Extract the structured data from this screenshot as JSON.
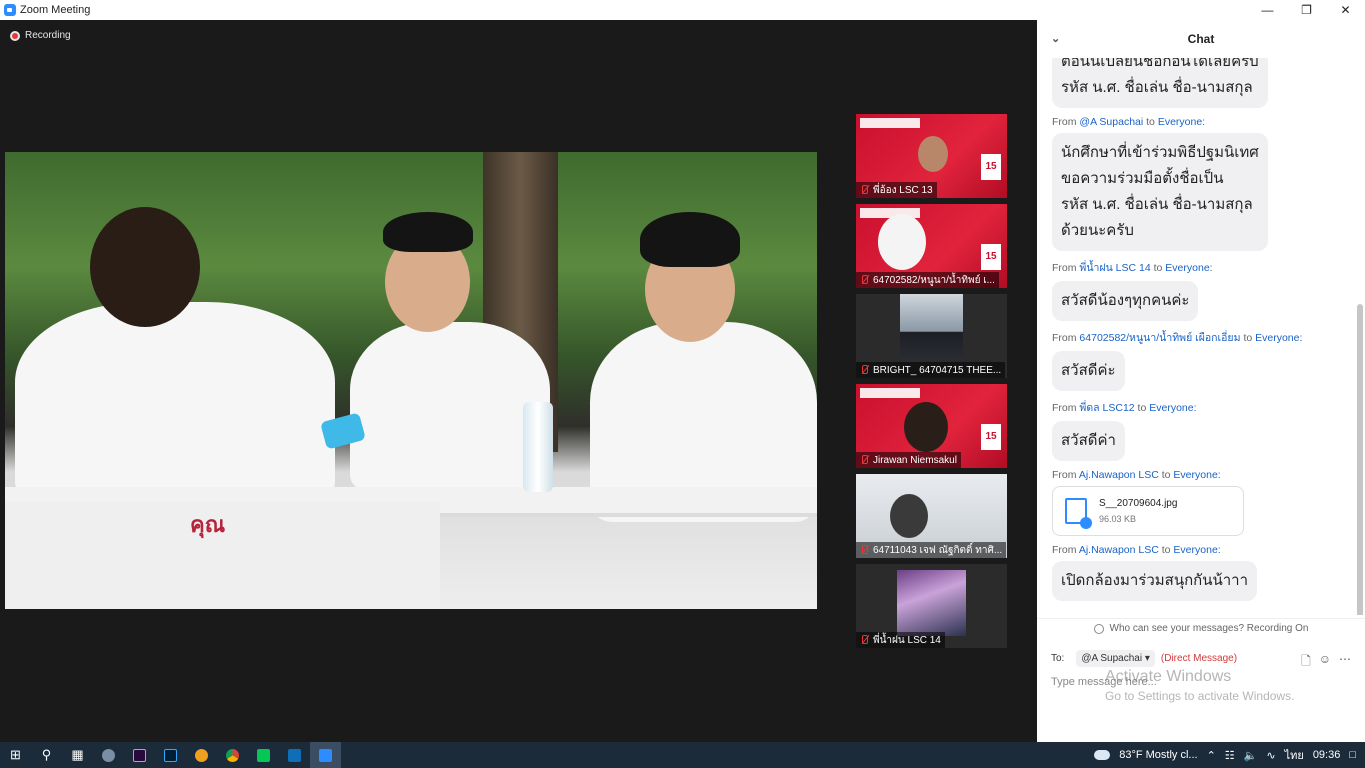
{
  "window": {
    "title": "Zoom Meeting"
  },
  "meeting": {
    "recording_label": "Recording",
    "participants": [
      {
        "name": "พี่อ้อง LSC 13",
        "style": "red"
      },
      {
        "name": "64702582/หนูนา/น้ำทิพย์ เ...",
        "style": "red"
      },
      {
        "name": "BRIGHT_ 64704715 THEE...",
        "style": "dark"
      },
      {
        "name": "Jirawan Niemsakul",
        "style": "red"
      },
      {
        "name": "64711043 เจฟ ณัฐกิตติ์ ทาศิ...",
        "style": "light"
      },
      {
        "name": "พี่น้ำฝน LSC 14",
        "style": "dark"
      }
    ],
    "thumb_date": "15",
    "sticker_text": "คุณ"
  },
  "chat": {
    "title": "Chat",
    "messages": [
      {
        "type": "text",
        "text": "ต้อนนี้เปลี่ยนชื่อก่อนได้เลยครับ\nรหัส น.ศ. ชื่อเล่น ชื่อ-นามสกุล"
      },
      {
        "type": "text",
        "from": "@A Supachai",
        "to": "Everyone:",
        "text": "นักศึกษาที่เข้าร่วมพิธีปฐมนิเทศ\nขอความร่วมมือตั้งชื่อเป็น\nรหัส น.ศ. ชื่อเล่น ชื่อ-นามสกุล\nด้วยนะครับ"
      },
      {
        "type": "text",
        "from": "พี่น้ำฝน LSC 14",
        "to": "Everyone:",
        "text": "สวัสดีน้องๆทุกคนค่ะ"
      },
      {
        "type": "text",
        "from": "64702582/หนูนา/น้ำทิพย์ เผือกเอี่ยม",
        "to": "Everyone:",
        "text": "สวัสดีค่ะ"
      },
      {
        "type": "text",
        "from": "พี่ดล LSC12",
        "to": "Everyone:",
        "text": "สวัสดีค่า"
      },
      {
        "type": "file",
        "from": "Aj.Nawapon LSC",
        "to": "Everyone:",
        "file_name": "S__20709604.jpg",
        "file_size": "96.03 KB"
      },
      {
        "type": "text",
        "from": "Aj.Nawapon LSC",
        "to": "Everyone:",
        "text": "เปิดกล้องมาร่วมสนุกกันน้าาา"
      }
    ],
    "from_label": "From",
    "to_label": "to",
    "privacy_note": "Who can see your messages? Recording On",
    "to_prefix": "To:",
    "recipient": "@A Supachai",
    "direct_label": "(Direct Message)",
    "input_placeholder": "Type message here...",
    "watermark_title": "Activate Windows",
    "watermark_sub": "Go to Settings to activate Windows."
  },
  "taskbar": {
    "weather": "83°F  Mostly cl...",
    "language": "ไทย",
    "time": "09:36"
  },
  "colors": {
    "zoom_blue": "#2d8cff",
    "sender_blue": "#1a63c8",
    "muted_red": "#e23a3a",
    "direct_red": "#d13a3a"
  }
}
